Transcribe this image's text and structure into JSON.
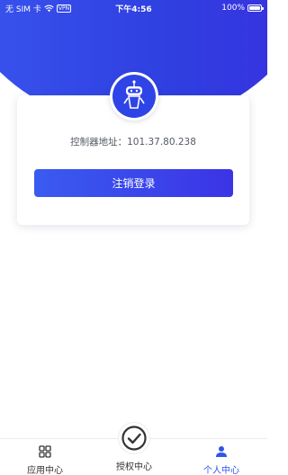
{
  "status_bar": {
    "carrier": "无 SIM 卡",
    "vpn": "VPN",
    "time": "下午4:56",
    "battery": "100%"
  },
  "card": {
    "controller_label": "控制器地址：",
    "controller_address": "101.37.80.238",
    "logout_label": "注销登录"
  },
  "tabs": [
    {
      "label": "应用中心",
      "icon": "grid-icon"
    },
    {
      "label": "授权中心",
      "icon": "check-circle-icon"
    },
    {
      "label": "个人中心",
      "icon": "person-icon",
      "active": true
    }
  ],
  "colors": {
    "primary": "#2f44e6",
    "active_tab": "#2e57e8"
  }
}
